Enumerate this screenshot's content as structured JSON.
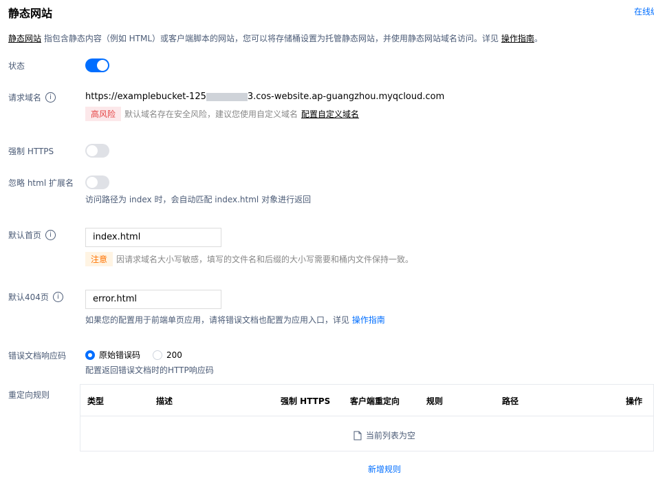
{
  "header": {
    "title": "静态网站",
    "online_link": "在线编"
  },
  "description": {
    "link1": "静态网站",
    "text": " 指包含静态内容（例如 HTML）或客户端脚本的网站，您可以将存储桶设置为托管静态网站，并使用静态网站域名访问。详见 ",
    "link2": "操作指南",
    "suffix": "。"
  },
  "status": {
    "label": "状态",
    "enabled": true
  },
  "domain": {
    "label": "请求域名",
    "url_prefix": "https://examplebucket-125",
    "url_suffix": "3.cos-website.ap-guangzhou.myqcloud.com",
    "risk_tag": "高风险",
    "risk_text": "默认域名存在安全风险，建议您使用自定义域名",
    "custom_link": "配置自定义域名"
  },
  "force_https": {
    "label": "强制 HTTPS",
    "enabled": false
  },
  "ignore_ext": {
    "label": "忽略 html 扩展名",
    "enabled": false,
    "hint": "访问路径为 index 时，会自动匹配 index.html 对象进行返回"
  },
  "index_page": {
    "label": "默认首页",
    "value": "index.html",
    "tag": "注意",
    "text": "因请求域名大小写敏感，填写的文件名和后缀的大小写需要和桶内文件保持一致。"
  },
  "error_page": {
    "label": "默认404页",
    "value": "error.html",
    "hint": "如果您的配置用于前端单页应用，请将错误文档也配置为应用入口，详见 ",
    "link": "操作指南"
  },
  "error_code": {
    "label": "错误文档响应码",
    "option1": "原始错误码",
    "option2": "200",
    "selected": "原始错误码",
    "hint": "配置返回错误文档时的HTTP响应码"
  },
  "redirect": {
    "label": "重定向规则",
    "columns": [
      "类型",
      "描述",
      "强制 HTTPS",
      "客户端重定向",
      "规则",
      "路径",
      "操作"
    ],
    "empty_text": "当前列表为空",
    "add_label": "新增规则"
  },
  "colors": {
    "accent": "#006eff",
    "danger": "#e54545",
    "warning": "#ff7200",
    "label": "#4b5b76"
  }
}
